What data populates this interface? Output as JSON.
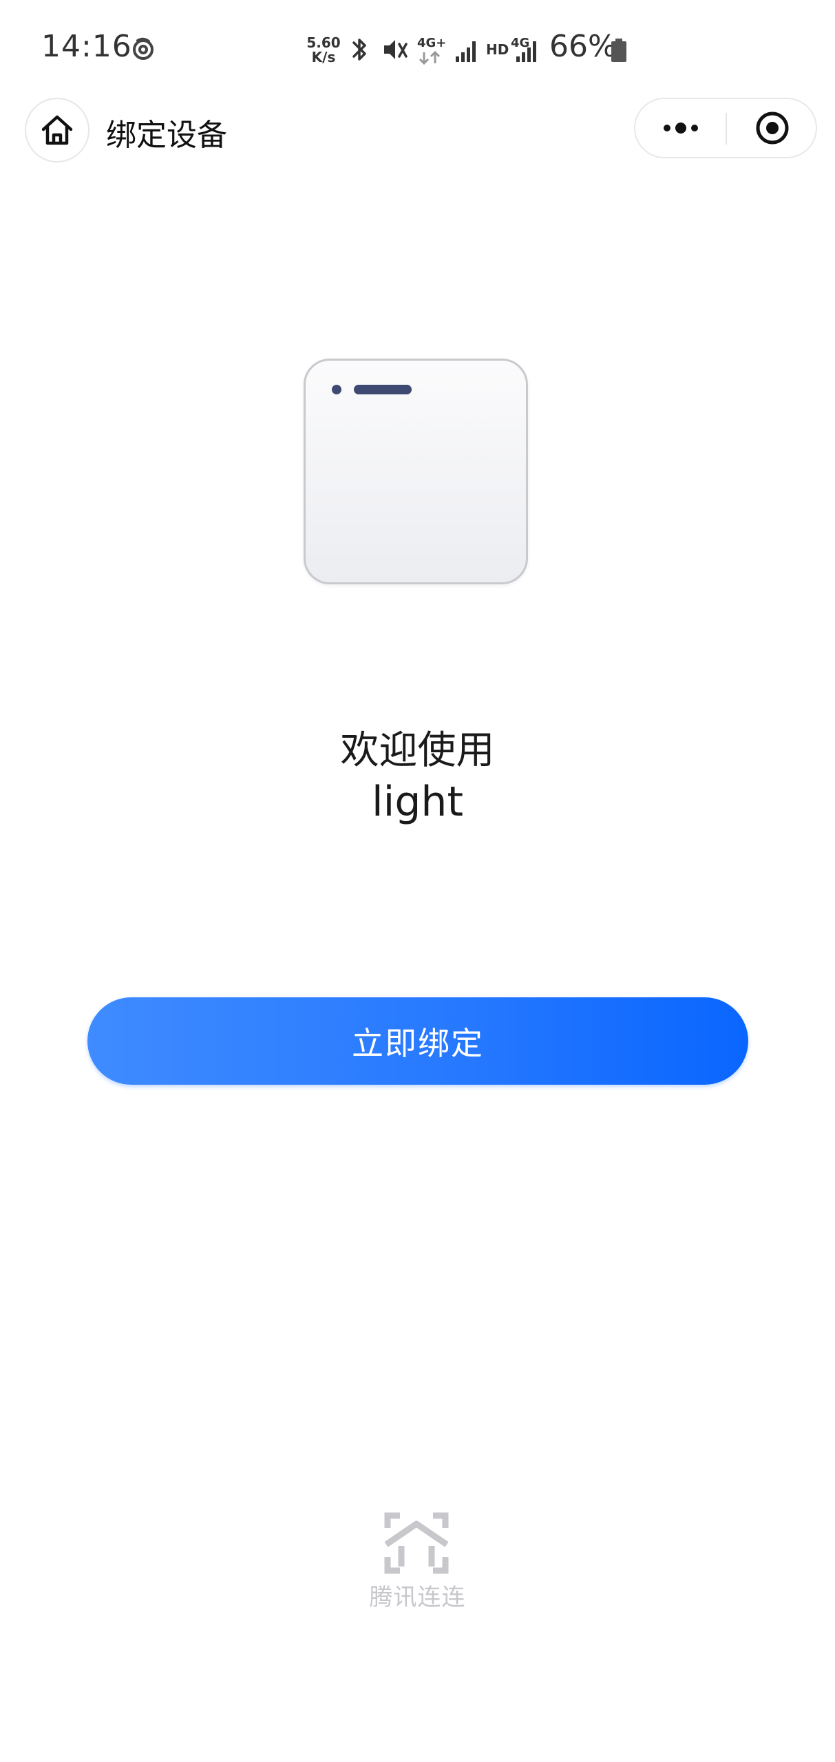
{
  "status_bar": {
    "time": "14:16",
    "network_speed_value": "5.60",
    "network_speed_unit": "K/s",
    "network_type_1": "4G+",
    "hd_label": "HD",
    "network_type_2": "4G",
    "battery_percent": "66%",
    "icons": [
      "app-notification-icon",
      "bluetooth-icon",
      "vibrate-mute-icon",
      "data-arrows-icon",
      "signal-icon",
      "signal-icon",
      "battery-icon"
    ]
  },
  "nav": {
    "title": "绑定设备",
    "icons": [
      "home-icon",
      "more-icon",
      "close-miniprogram-icon"
    ]
  },
  "device": {
    "icon": "device-card-icon",
    "colors": {
      "indicator": "#3e4a72",
      "border": "#c9c9ce"
    }
  },
  "welcome": {
    "title": "欢迎使用",
    "device_name": "light"
  },
  "actions": {
    "bind_label": "立即绑定",
    "bind_color_start": "#3f8bff",
    "bind_color_end": "#0a66ff"
  },
  "footer": {
    "brand_icon": "tencent-lianlian-logo-icon",
    "label": "腾讯连连",
    "color": "#c7c7cc"
  }
}
